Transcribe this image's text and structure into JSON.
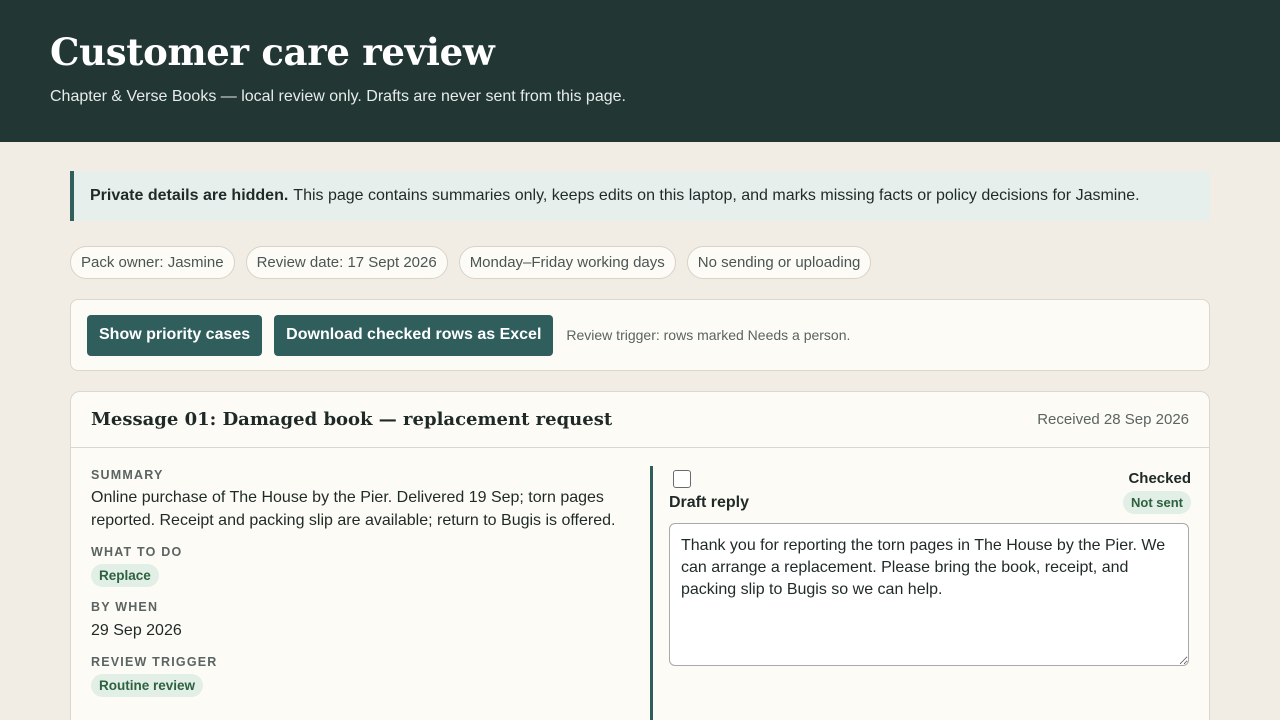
{
  "header": {
    "title": "Customer care review",
    "subtitle": "Chapter & Verse Books — local review only. Drafts are never sent from this page."
  },
  "notice": {
    "bold": "Private details are hidden.",
    "text": "This page contains summaries only, keeps edits on this laptop, and marks missing facts or policy decisions for Jasmine."
  },
  "chips": [
    "Pack owner: Jasmine",
    "Review date: 17 Sept 2026",
    "Monday–Friday working days",
    "No sending or uploading"
  ],
  "toolbar": {
    "priority_button": "Show priority cases",
    "download_button": "Download checked rows as Excel",
    "trigger_note": "Review trigger: rows marked Needs a person."
  },
  "message": {
    "title": "Message 01: Damaged book — replacement request",
    "received": "Received 28 Sep 2026",
    "summary_label": "Summary",
    "summary": "Online purchase of The House by the Pier. Delivered 19 Sep; torn pages reported. Receipt and packing slip are available; return to Bugis is offered.",
    "action_label": "What to do",
    "action": "Replace",
    "by_when_label": "By when",
    "by_when": "29 Sep 2026",
    "trigger_label": "Review trigger",
    "trigger": "Routine review",
    "checked_label": "Checked",
    "checked": false,
    "draft_label": "Draft reply",
    "status": "Not sent",
    "draft": "Thank you for reporting the torn pages in The House by the Pier. We can arrange a replacement. Please bring the book, receipt, and packing slip to Bugis so we can help."
  },
  "colors": {
    "header_bg": "#223634",
    "accent": "#2f5e5d",
    "page_bg": "#f1ede5",
    "pill_bg": "#e2efe6",
    "pill_text": "#2e6140"
  }
}
